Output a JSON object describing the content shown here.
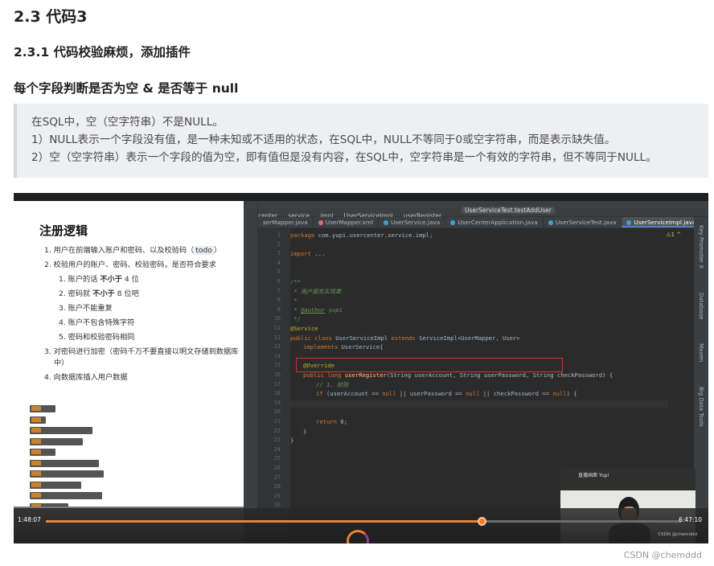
{
  "article": {
    "h2": "2.3 代码3",
    "h3": "2.3.1 代码校验麻烦，添加插件",
    "h4": "每个字段判断是否为空 & 是否等于 null",
    "quote": [
      "在SQL中，空（空字符串）不是NULL。",
      "1）NULL表示一个字段没有值，是一种未知或不适用的状态，在SQL中，NULL不等同于0或空字符串，而是表示缺失值。",
      "2）空（空字符串）表示一个字段的值为空，即有值但是没有内容，在SQL中，空字符串是一个有效的字符串，但不等同于NULL。"
    ]
  },
  "video": {
    "notes": {
      "title": "注册逻辑",
      "items": [
        "1. 用户在前端输入账户和密码、以及校验码（todo）",
        "2. 校验用户的账户、密码、校验密码，是否符合要求",
        "1. 账户的话 不小于 4 位",
        "2. 密码就 不小于 8 位吧",
        "3. 账户不能重复",
        "4. 账户不包含特殊字符",
        "5. 密码和校验密码相同",
        "3. 对密码进行加密（密码千万不要直接以明文存储到数据库",
        "中）",
        "4. 向数据库插入用户数据"
      ]
    },
    "ide": {
      "breadcrumb": [
        "center",
        "service",
        "impl",
        "UserServiceImpl",
        "userRegister"
      ],
      "run_config": "UserServiceTest.testAddUser",
      "tabs": [
        "serMapper.java",
        "UserMapper.xml",
        "UserService.java",
        "UserCenterApplication.java",
        "UserServiceTest.java",
        "UserServiceImpl.java"
      ],
      "active_tab_index": 5,
      "warnings": "⚠1 ^",
      "side_panels": [
        "Key Promoter X",
        "Database",
        "Maven",
        "Big Data Tools"
      ],
      "line_numbers": [
        "1",
        "2",
        "3",
        "4",
        "5",
        "6",
        "7",
        "8",
        "9",
        "10",
        "11",
        "12",
        "13",
        "14",
        "15",
        "16",
        "17",
        "18",
        "19",
        "20",
        "21",
        "22",
        "23",
        "24",
        "25",
        "26",
        "27",
        "28",
        "29",
        "30",
        "31"
      ],
      "code": {
        "l1_kw": "package",
        "l1": " com.yupi.usercenter.service.impl;",
        "l3_kw": "import",
        "l3": " ...",
        "l6": "/**",
        "l7": " * 用户服务实现类",
        "l8": " *",
        "l9_pre": " * ",
        "l9_tag": "@author",
        "l9": " yupi",
        "l10": " */",
        "l11": "@Service",
        "l12_kw": "public class",
        "l12": " UserServiceImpl ",
        "l12_kw2": "extends",
        "l12_b": " ServiceImpl<UserMapper, User>",
        "l13_kw": "implements",
        "l13": " UserService{",
        "l15": "@Override",
        "l16_kw": "public long",
        "l16_fn": " userRegister",
        "l16": "(String userAccount, String userPassword, String checkPassword) {",
        "l17": "// 1. 校验",
        "l18_kw": "if",
        "l18": " (userAccount == ",
        "l18_n1": "null",
        "l18_b": " || userPassword == ",
        "l18_n2": "null",
        "l18_c": " || checkPassword == ",
        "l18_n3": "null",
        "l18_d": ") {",
        "l21_kw": "return",
        "l21": " 0;",
        "l22": "}",
        "l23": "}"
      }
    },
    "camera_label": "直播画面 Yupi",
    "player": {
      "current_time": "1:48:07",
      "duration": "6:47:10",
      "progress": 0.687
    },
    "watermark": "CSDN @chemddd"
  },
  "footer": {
    "csdn": "CSDN @chemddd"
  }
}
